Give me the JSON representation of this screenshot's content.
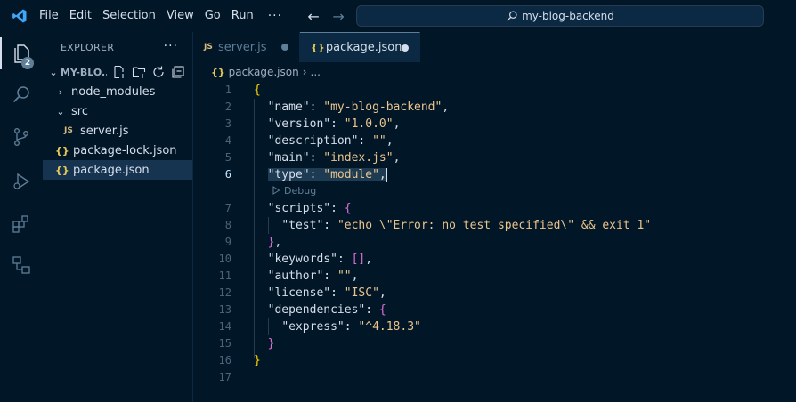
{
  "menu": {
    "file": "File",
    "edit": "Edit",
    "selection": "Selection",
    "view": "View",
    "go": "Go",
    "run": "Run",
    "more": "···"
  },
  "search": {
    "text": "my-blog-backend"
  },
  "activity": {
    "explorer_badge": "2"
  },
  "explorer": {
    "title": "EXPLORER",
    "more": "···",
    "folder": "MY-BLO...",
    "tree": [
      {
        "label": "node_modules",
        "type": "folder"
      },
      {
        "label": "src",
        "type": "folder"
      },
      {
        "label": "server.js",
        "type": "js",
        "badge": "JS"
      },
      {
        "label": "package-lock.json",
        "type": "json",
        "badge": "{}"
      },
      {
        "label": "package.json",
        "type": "json",
        "badge": "{}",
        "selected": true
      }
    ]
  },
  "tabs": [
    {
      "label": "server.js",
      "badge": "JS",
      "active": false
    },
    {
      "label": "package.json",
      "badge": "{}",
      "active": true
    }
  ],
  "breadcrumb": {
    "file": "package.json",
    "sep": "›",
    "more": "..."
  },
  "codelens": {
    "label": "Debug"
  },
  "code": {
    "line_numbers": [
      "1",
      "2",
      "3",
      "4",
      "5",
      "6",
      "7",
      "8",
      "9",
      "10",
      "11",
      "12",
      "13",
      "14",
      "15",
      "16",
      "17"
    ],
    "name_key": "\"name\"",
    "name_val": "\"my-blog-backend\"",
    "version_key": "\"version\"",
    "version_val": "\"1.0.0\"",
    "description_key": "\"description\"",
    "description_val": "\"\"",
    "main_key": "\"main\"",
    "main_val": "\"index.js\"",
    "type_key": "\"type\"",
    "type_val": "\"module\"",
    "scripts_key": "\"scripts\"",
    "test_key": "\"test\"",
    "test_val": "\"echo \\\"Error: no test specified\\\" && exit 1\"",
    "keywords_key": "\"keywords\"",
    "keywords_val": "[]",
    "author_key": "\"author\"",
    "author_val": "\"\"",
    "license_key": "\"license\"",
    "license_val": "\"ISC\"",
    "dependencies_key": "\"dependencies\"",
    "express_key": "\"express\"",
    "express_val": "\"^4.18.3\""
  },
  "colors": {
    "background": "#011627",
    "accent": "#0b2942",
    "string": "#ecc48d"
  }
}
